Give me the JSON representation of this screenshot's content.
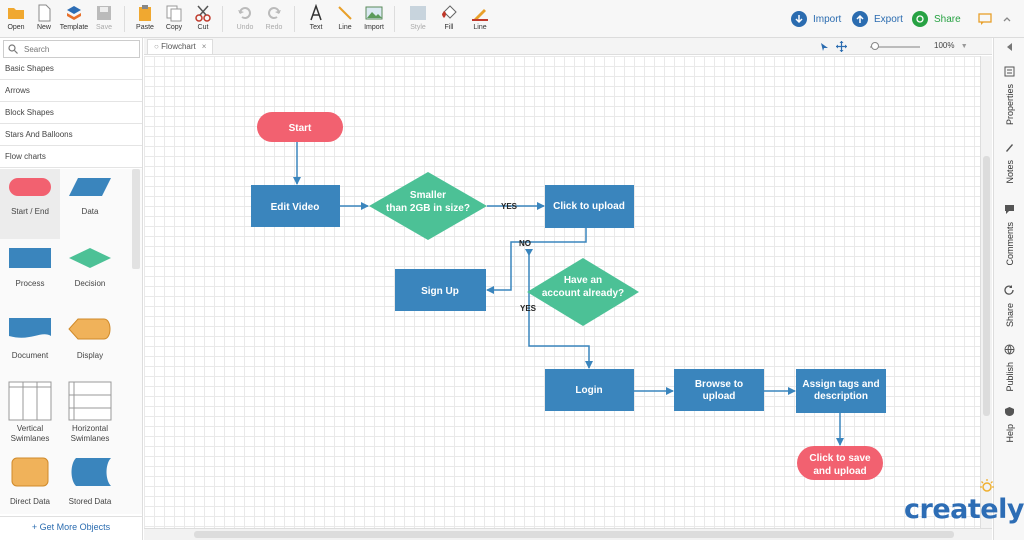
{
  "toolbar": {
    "left_buttons": [
      {
        "label": "Open",
        "icon": "folder-icon"
      },
      {
        "label": "New",
        "icon": "new-document-icon"
      },
      {
        "label": "Template",
        "icon": "template-icon"
      },
      {
        "label": "Save",
        "icon": "save-icon"
      }
    ],
    "edit_buttons": [
      {
        "label": "Paste",
        "icon": "paste-icon"
      },
      {
        "label": "Copy",
        "icon": "copy-icon"
      },
      {
        "label": "Cut",
        "icon": "scissors-icon"
      }
    ],
    "history_buttons": [
      {
        "label": "Undo",
        "icon": "undo-icon"
      },
      {
        "label": "Redo",
        "icon": "redo-icon"
      }
    ],
    "insert_buttons": [
      {
        "label": "Text",
        "icon": "text-icon"
      },
      {
        "label": "Line",
        "icon": "line-icon"
      },
      {
        "label": "Import",
        "icon": "image-icon"
      }
    ],
    "style_buttons": [
      {
        "label": "Style",
        "icon": "style-icon"
      },
      {
        "label": "Fill",
        "icon": "fill-bucket-icon"
      },
      {
        "label": "Line",
        "icon": "line-color-icon"
      }
    ],
    "import_label": "Import",
    "export_label": "Export",
    "share_label": "Share"
  },
  "left_panel": {
    "search_placeholder": "Search",
    "categories": [
      "Basic Shapes",
      "Arrows",
      "Block Shapes",
      "Stars And Balloons",
      "Flow charts"
    ],
    "shapes": [
      {
        "label": "Start / End"
      },
      {
        "label": "Data"
      },
      {
        "label": "Process"
      },
      {
        "label": "Decision"
      },
      {
        "label": "Document"
      },
      {
        "label": "Display"
      },
      {
        "label": "Vertical Swimlanes"
      },
      {
        "label": "Horizontal Swimlanes"
      },
      {
        "label": "Direct Data"
      },
      {
        "label": "Stored Data"
      }
    ],
    "more_objects": "+ Get More Objects"
  },
  "tab": {
    "label": "Flowchart",
    "close": "×"
  },
  "zoom": {
    "value": "100%",
    "arrow": "▼"
  },
  "flowchart": {
    "start": "Start",
    "edit_video": "Edit Video",
    "smaller_line1": "Smaller",
    "smaller_line2": "than 2GB  in size?",
    "yes1": "YES",
    "click_upload": "Click to upload",
    "no": "NO",
    "sign_up": "Sign Up",
    "account_line1": "Have an",
    "account_line2": "account  already?",
    "yes2": "YES",
    "login": "Login",
    "browse_line1": "Browse to",
    "browse_line2": "upload",
    "assign_line1": "Assign tags and",
    "assign_line2": "description",
    "save_line1": "Click to save",
    "save_line2": "and upload"
  },
  "right_panel": [
    "Properties",
    "Notes",
    "Comments",
    "Share",
    "Publish",
    "Help"
  ],
  "logo": "creately",
  "colors": {
    "terminal": "#f26170",
    "process": "#3a85bd",
    "decision": "#4cc196",
    "connector": "#3a85bd",
    "accent": "#2b6cb0"
  }
}
